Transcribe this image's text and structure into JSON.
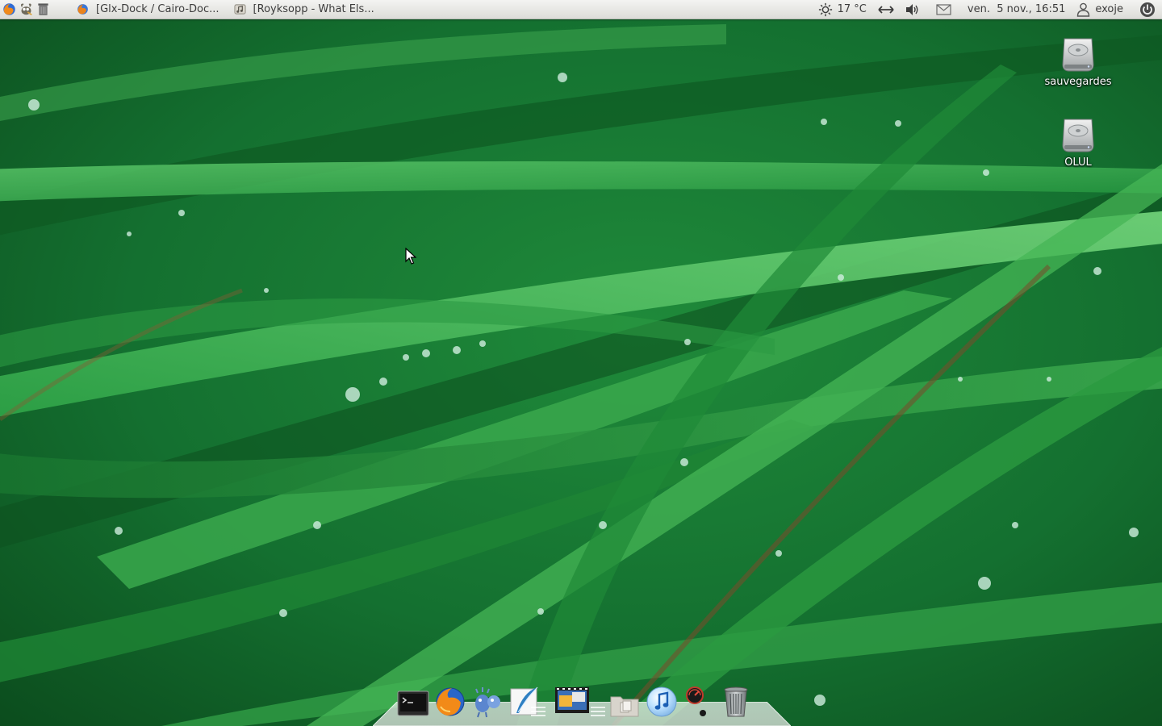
{
  "panel": {
    "launchers": [
      {
        "name": "firefox-launcher",
        "icon": "firefox-icon"
      },
      {
        "name": "gimp-launcher",
        "icon": "gimp-icon"
      },
      {
        "name": "trash-launcher",
        "icon": "trash-icon"
      }
    ],
    "tasks": [
      {
        "label": "[Glx-Dock / Cairo-Doc...",
        "icon": "firefox-icon"
      },
      {
        "label": "[Royksopp - What Els...",
        "icon": "music-player-icon"
      }
    ],
    "weather": {
      "icon": "sun-icon",
      "text": "17 °C"
    },
    "network_icon": "network-arrows-icon",
    "volume_icon": "speaker-icon",
    "mail_icon": "envelope-icon",
    "clock": "ven.  5 nov., 16:51",
    "user": {
      "icon": "user-icon",
      "name": "exoje"
    },
    "session_icon": "power-icon"
  },
  "desktop": {
    "icons": [
      {
        "label": "sauvegardes",
        "icon": "hard-drive-icon"
      },
      {
        "label": "OLUL",
        "icon": "hard-drive-icon"
      }
    ]
  },
  "dock": {
    "items": [
      {
        "name": "terminal",
        "icon": "terminal-icon"
      },
      {
        "name": "firefox",
        "icon": "firefox-icon"
      },
      {
        "name": "pidgin",
        "icon": "pidgin-icon"
      },
      {
        "name": "text-editor",
        "icon": "quill-icon"
      },
      {
        "name": "media-stack",
        "icon": "film-stack-icon"
      },
      {
        "name": "files-stack",
        "icon": "folder-stack-icon"
      },
      {
        "name": "music-player",
        "icon": "music-note-icon"
      },
      {
        "name": "system-monitor",
        "icon": "gauge-icon"
      },
      {
        "name": "trash",
        "icon": "trash-icon"
      }
    ]
  },
  "colors": {
    "panel_top": "#f4f4f2",
    "panel_bottom": "#dcdcd8",
    "grass_dark": "#0c4a1b",
    "grass_light": "#46b95a"
  }
}
